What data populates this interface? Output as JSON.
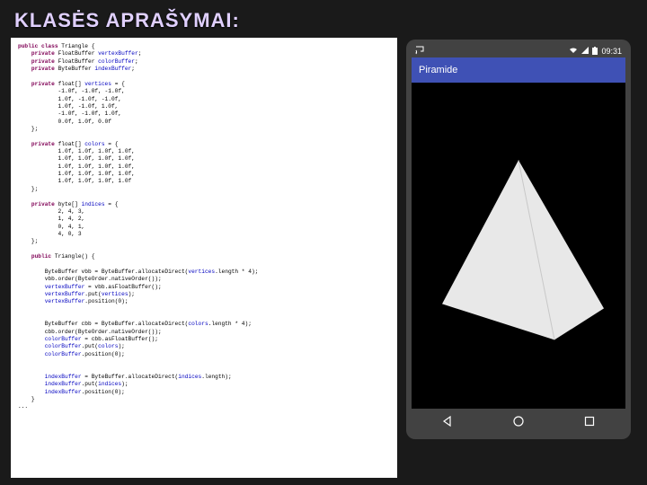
{
  "title": "KLASĖS APRAŠYMAI:",
  "code": {
    "line1_kw": "public class",
    "line1_rest": " Triangle {",
    "line2_kw": "    private",
    "line2_rest": " FloatBuffer ",
    "line2_fld": "vertexBuffer",
    "line3_kw": "    private",
    "line3_rest": " FloatBuffer ",
    "line3_fld": "colorBuffer",
    "line4_kw": "    private",
    "line4_rest": " ByteBuffer ",
    "line4_fld": "indexBuffer",
    "vert_kw": "    private",
    "vert_rest": " float[] ",
    "vert_fld": "vertices",
    "vert_eq": " = {",
    "vert_l1": "            -1.0f, -1.0f, -1.0f,",
    "vert_l2": "            1.0f, -1.0f, -1.0f,",
    "vert_l3": "            1.0f, -1.0f, 1.0f,",
    "vert_l4": "            -1.0f, -1.0f, 1.0f,",
    "vert_l5": "            0.0f, 1.0f, 0.0f",
    "vert_close": "    };",
    "col_kw": "    private",
    "col_rest": " float[] ",
    "col_fld": "colors",
    "col_eq": " = {",
    "col_l1": "            1.0f, 1.0f, 1.0f, 1.0f,",
    "col_l2": "            1.0f, 1.0f, 1.0f, 1.0f,",
    "col_l3": "            1.0f, 1.0f, 1.0f, 1.0f,",
    "col_l4": "            1.0f, 1.0f, 1.0f, 1.0f,",
    "col_l5": "            1.0f, 1.0f, 1.0f, 1.0f",
    "col_close": "    };",
    "idx_kw": "    private",
    "idx_rest": " byte[] ",
    "idx_fld": "indices",
    "idx_eq": " = {",
    "idx_l1": "            2, 4, 3,",
    "idx_l2": "            1, 4, 2,",
    "idx_l3": "            0, 4, 1,",
    "idx_l4": "            4, 0, 3",
    "idx_close": "    };",
    "ctor_kw": "    public",
    "ctor_rest": " Triangle() {",
    "vbb1": "        ByteBuffer vbb = ByteBuffer.allocateDirect(",
    "vbb1f": "vertices",
    "vbb1e": ".length * 4);",
    "vbb2": "        vbb.order(ByteOrder.nativeOrder());",
    "vbb3a": "        ",
    "vbb3f": "vertexBuffer",
    "vbb3b": " = vbb.asFloatBuffer();",
    "vbb4a": "        ",
    "vbb4f": "vertexBuffer",
    "vbb4b": ".put(",
    "vbb4c": "vertices",
    "vbb4d": ");",
    "vbb5a": "        ",
    "vbb5f": "vertexBuffer",
    "vbb5b": ".position(0);",
    "cbb1": "        ByteBuffer cbb = ByteBuffer.allocateDirect(",
    "cbb1f": "colors",
    "cbb1e": ".length * 4);",
    "cbb2": "        cbb.order(ByteOrder.nativeOrder());",
    "cbb3a": "        ",
    "cbb3f": "colorBuffer",
    "cbb3b": " = cbb.asFloatBuffer();",
    "cbb4a": "        ",
    "cbb4f": "colorBuffer",
    "cbb4b": ".put(",
    "cbb4c": "colors",
    "cbb4d": ");",
    "cbb5a": "        ",
    "cbb5f": "colorBuffer",
    "cbb5b": ".position(0);",
    "ibb1a": "        ",
    "ibb1f": "indexBuffer",
    "ibb1b": " = ByteBuffer.allocateDirect(",
    "ibb1c": "indices",
    "ibb1d": ".length);",
    "ibb2a": "        ",
    "ibb2f": "indexBuffer",
    "ibb2b": ".put(",
    "ibb2c": "indices",
    "ibb2d": ");",
    "ibb3a": "        ",
    "ibb3f": "indexBuffer",
    "ibb3b": ".position(0);",
    "ctor_close": "    }",
    "dots": "..."
  },
  "phone": {
    "app_name": "Piramide",
    "time": "09:31",
    "triangle_color": "#e8e8e8"
  },
  "icons": {
    "cast": "cast-icon",
    "wifi": "wifi-icon",
    "signal": "signal-icon",
    "battery": "battery-icon",
    "back": "◁",
    "home": "○",
    "recent": "□"
  }
}
